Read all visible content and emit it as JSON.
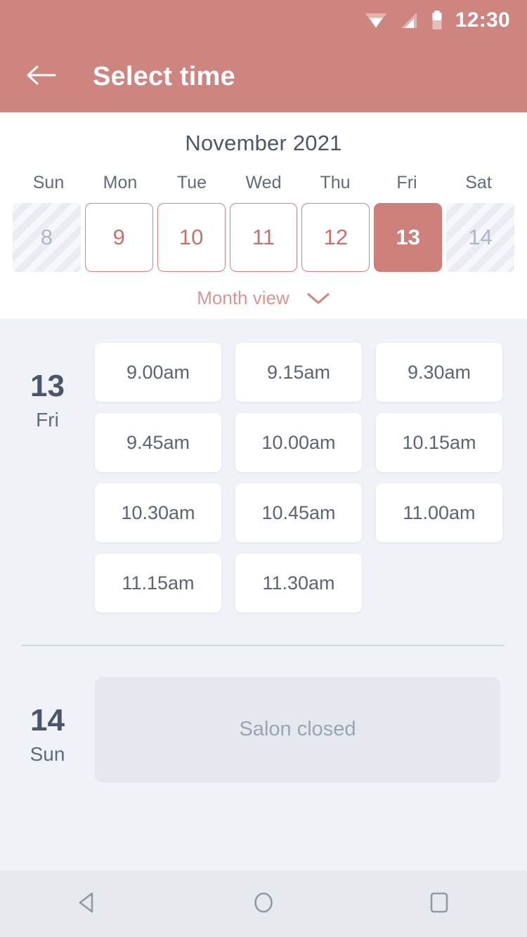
{
  "status_bar": {
    "time": "12:30",
    "icons": [
      "wifi-icon",
      "cellular-signal-icon",
      "battery-icon"
    ]
  },
  "app_bar": {
    "back_icon": "back-arrow-icon",
    "title": "Select time"
  },
  "calendar": {
    "month_title": "November 2021",
    "weekdays": [
      "Sun",
      "Mon",
      "Tue",
      "Wed",
      "Thu",
      "Fri",
      "Sat"
    ],
    "dates": [
      {
        "label": "8",
        "state": "disabled"
      },
      {
        "label": "9",
        "state": "available"
      },
      {
        "label": "10",
        "state": "available"
      },
      {
        "label": "11",
        "state": "available"
      },
      {
        "label": "12",
        "state": "available"
      },
      {
        "label": "13",
        "state": "selected"
      },
      {
        "label": "14",
        "state": "disabled"
      }
    ],
    "month_view_label": "Month view",
    "month_view_icon": "chevron-down-icon"
  },
  "days": [
    {
      "day_number": "13",
      "day_name": "Fri",
      "slots": [
        "9.00am",
        "9.15am",
        "9.30am",
        "9.45am",
        "10.00am",
        "10.15am",
        "10.30am",
        "10.45am",
        "11.00am",
        "11.15am",
        "11.30am"
      ]
    },
    {
      "day_number": "14",
      "day_name": "Sun",
      "closed_message": "Salon closed"
    }
  ],
  "nav_bar": {
    "back_icon": "android-back-icon",
    "home_icon": "android-home-icon",
    "recents_icon": "android-recents-icon"
  },
  "colors": {
    "brand_rose": "#CE8580",
    "selected_rose": "#CD7F79",
    "body_bg": "#EFF2F7",
    "text_slate": "#4B566B",
    "muted_slate": "#9AA4B6"
  }
}
